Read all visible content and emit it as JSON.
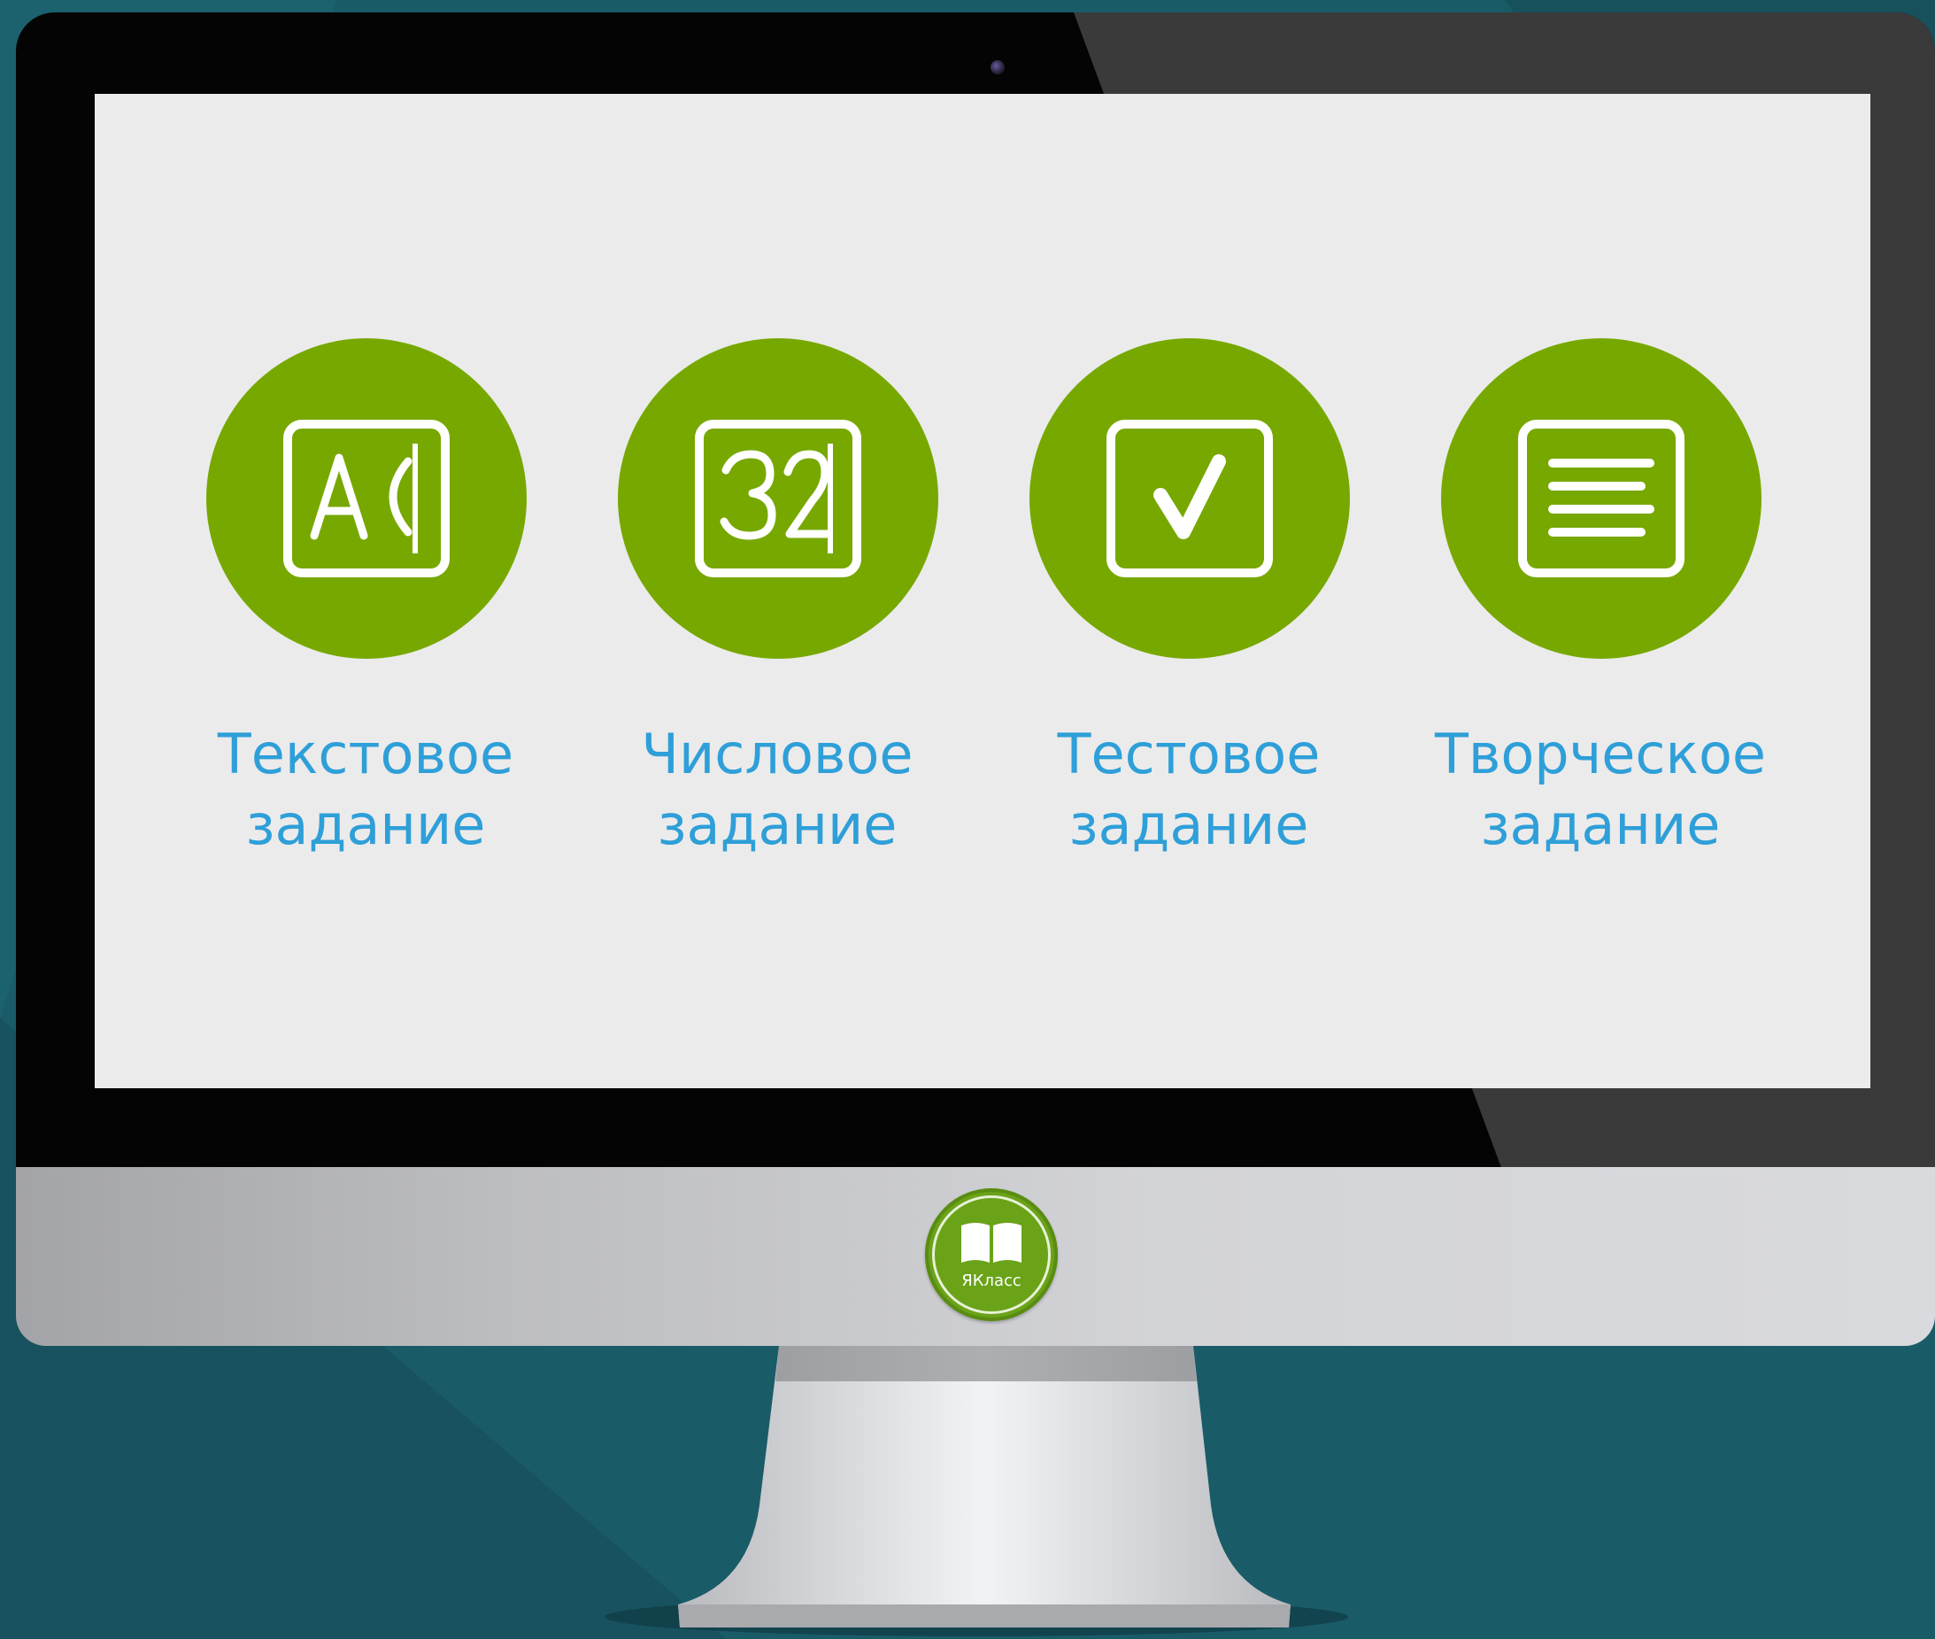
{
  "tiles": [
    {
      "label_line1": "Текстовое",
      "label_line2": "задание",
      "icon": "text-task-icon"
    },
    {
      "label_line1": "Числовое",
      "label_line2": "задание",
      "icon": "number-task-icon"
    },
    {
      "label_line1": "Тестовое",
      "label_line2": "задание",
      "icon": "test-checkbox-icon"
    },
    {
      "label_line1": "Творческое",
      "label_line2": "задание",
      "icon": "creative-text-icon"
    }
  ],
  "brand": {
    "name": "ЯКласс",
    "logo_icon": "book-icon"
  },
  "colors": {
    "accent_green": "#77a800",
    "label_blue": "#2e9fd8",
    "screen_bg": "#ebebeb",
    "page_bg": "#1a5b68"
  }
}
